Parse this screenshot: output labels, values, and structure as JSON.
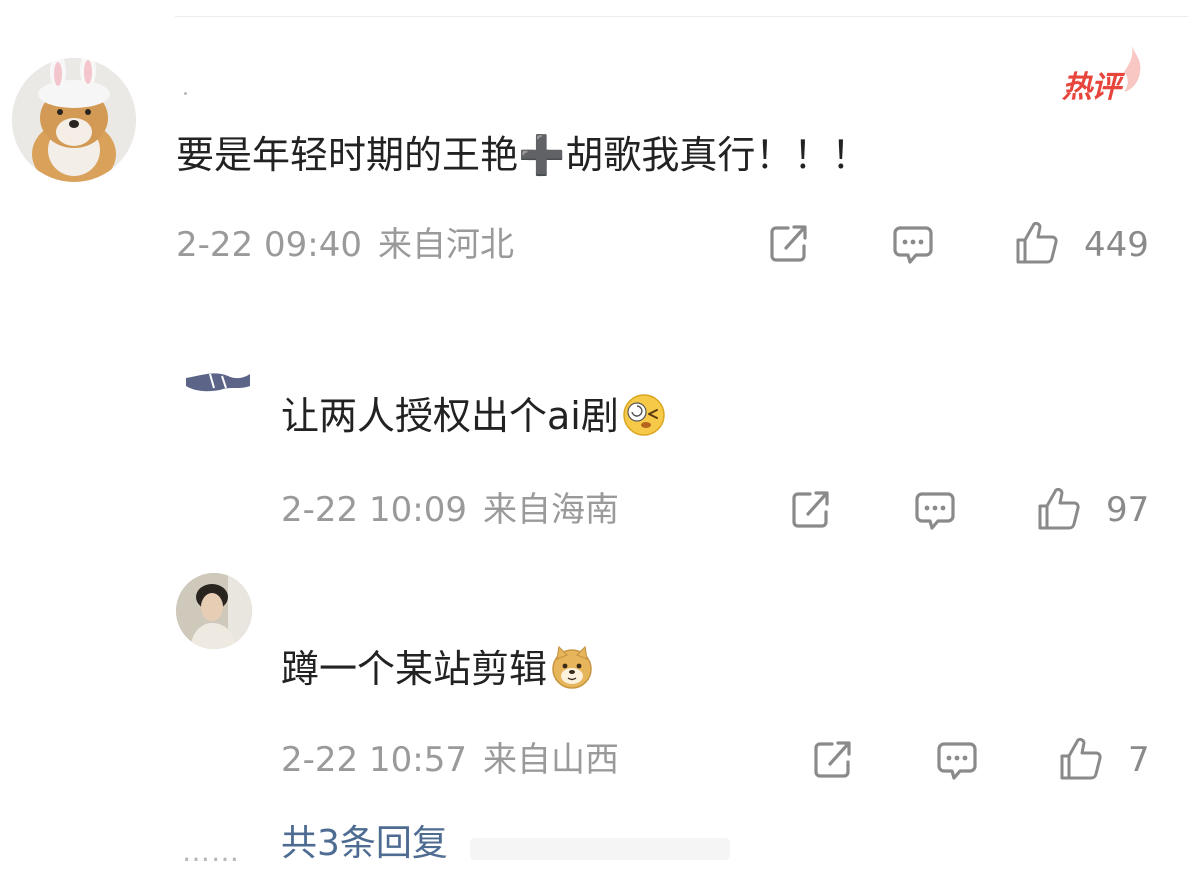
{
  "comment": {
    "badge": "热评",
    "text": "要是年轻时期的王艳➕胡歌我真行！！！",
    "time": "2-22 09:40",
    "location": "来自河北",
    "likes": "449",
    "share_icon": "share-icon",
    "reply_icon": "comment-icon",
    "like_icon": "thumbs-up-icon"
  },
  "replies": [
    {
      "text": "让两人授权出个ai剧",
      "emoji": "dizzy-face-emoji",
      "time": "2-22 10:09",
      "location": "来自海南",
      "likes": "97"
    },
    {
      "text": "蹲一个某站剪辑",
      "emoji": "doge-emoji",
      "time": "2-22 10:57",
      "location": "来自山西",
      "likes": "7"
    }
  ],
  "more": {
    "dots": "……",
    "label": "共3条回复"
  },
  "colors": {
    "hot": "#e8453c",
    "link": "#4e6b92",
    "meta": "#9a9a9a"
  }
}
